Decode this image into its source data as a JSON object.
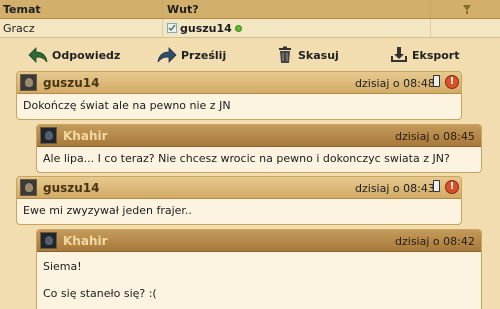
{
  "table": {
    "col_topic": "Temat",
    "col_wut": "Wut?",
    "row_topic": "Gracz",
    "row_player": "guszu14",
    "colors": {
      "online": "#5cbb2f"
    }
  },
  "toolbar": {
    "reply": "Odpowiedz",
    "forward": "Prześlij",
    "delete": "Skasuj",
    "export": "Eksport"
  },
  "messages": [
    {
      "author": "guszu14",
      "time": "dzisiaj o 08:48",
      "text": "Dokończę świat ale na pewno nie z JN"
    },
    {
      "author": "Khahir",
      "time": "dzisiaj o 08:45",
      "text": "Ale lipa... I co teraz? Nie chcesz wrocic na pewno i dokonczyc swiata z JN?"
    },
    {
      "author": "guszu14",
      "time": "dzisiaj o 08:43",
      "text": "Ewe mi zwyzywał jeden frajer.."
    },
    {
      "author": "Khahir",
      "time": "dzisiaj o 08:42",
      "lines": [
        "Siema!",
        "Co się staneło się? :("
      ]
    }
  ]
}
